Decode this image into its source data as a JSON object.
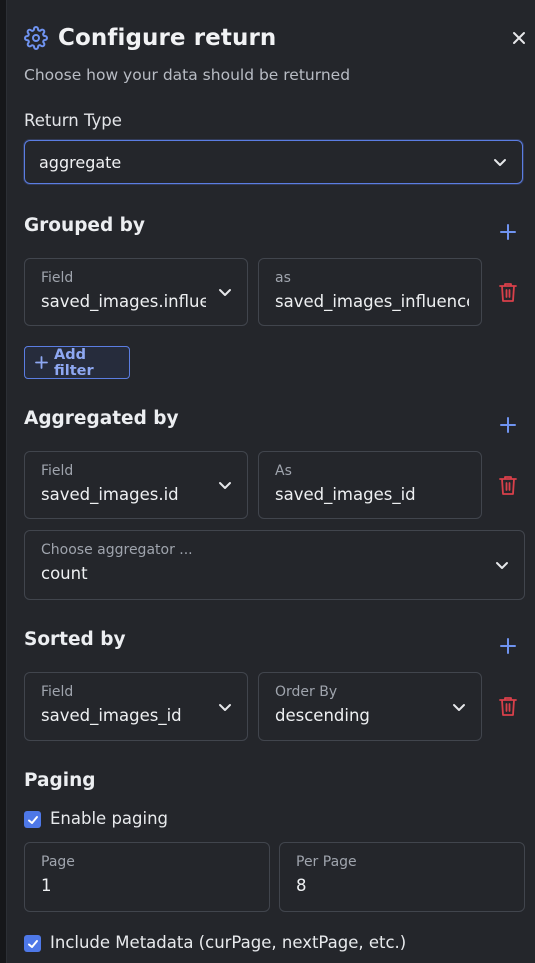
{
  "header": {
    "title": "Configure return",
    "subtitle": "Choose how your data should be returned"
  },
  "return_type": {
    "label": "Return Type",
    "value": "aggregate"
  },
  "grouped_by": {
    "title": "Grouped by",
    "field_label": "Field",
    "field_value": "saved_images.influe",
    "as_label": "as",
    "as_value": "saved_images_influence",
    "add_filter_label": "Add filter"
  },
  "aggregated_by": {
    "title": "Aggregated by",
    "field_label": "Field",
    "field_value": "saved_images.id",
    "as_label": "As",
    "as_value": "saved_images_id",
    "aggregator_label": "Choose aggregator ...",
    "aggregator_value": "count"
  },
  "sorted_by": {
    "title": "Sorted by",
    "field_label": "Field",
    "field_value": "saved_images_id",
    "order_label": "Order By",
    "order_value": "descending"
  },
  "paging": {
    "title": "Paging",
    "enable_label": "Enable paging",
    "enable_checked": true,
    "page_label": "Page",
    "page_value": "1",
    "per_page_label": "Per Page",
    "per_page_value": "8",
    "metadata_label": "Include Metadata (curPage, nextPage, etc.)",
    "metadata_checked": true
  },
  "colors": {
    "accent": "#5b7de2",
    "danger": "#d9404a",
    "background": "#24262b"
  }
}
